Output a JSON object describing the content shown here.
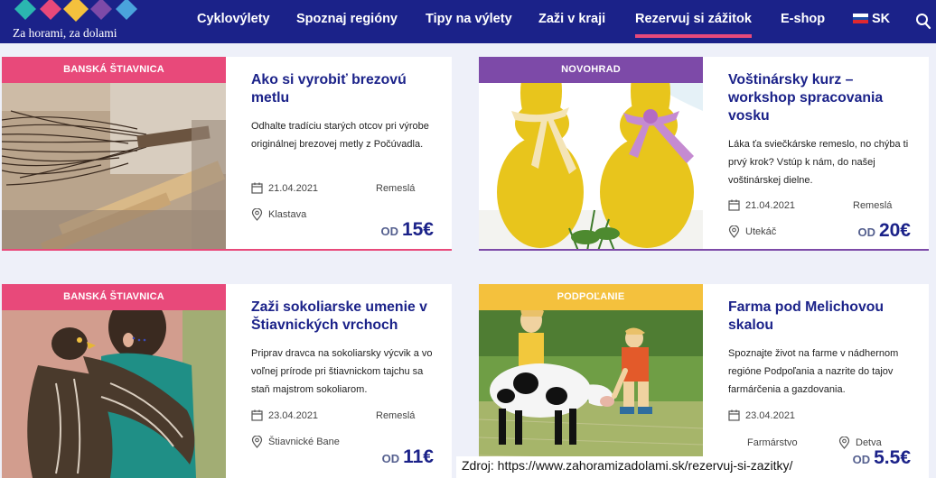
{
  "site": {
    "logo_text": "Za horami, za dolami"
  },
  "nav": {
    "items": [
      {
        "label": "Cyklovýlety"
      },
      {
        "label": "Spoznaj regióny"
      },
      {
        "label": "Tipy na výlety"
      },
      {
        "label": "Zaži v kraji"
      },
      {
        "label": "Rezervuj si zážitok",
        "active": true
      },
      {
        "label": "E-shop"
      }
    ],
    "language": "SK"
  },
  "cards": [
    {
      "region": "BANSKÁ ŠTIAVNICA",
      "region_color": "#e8497a",
      "title": "Ako si vyrobiť brezovú metlu",
      "description": "Odhalte tradíciu starých otcov pri výrobe originálnej brezovej metly z Počúvadla.",
      "date": "21.04.2021",
      "category": "Remeslá",
      "location": "Klastava",
      "price_prefix": "OD",
      "price": "15€"
    },
    {
      "region": "NOVOHRAD",
      "region_color": "#7d4aa8",
      "title": "Voštinársky kurz – workshop spracovania vosku",
      "description": "Láka ťa sviečkárske remeslo, no chýba ti prvý krok? Vstúp k nám, do našej voštinárskej dielne.",
      "date": "21.04.2021",
      "category": "Remeslá",
      "location": "Utekáč",
      "price_prefix": "OD",
      "price": "20€"
    },
    {
      "region": "BANSKÁ ŠTIAVNICA",
      "region_color": "#e8497a",
      "title": "Zaži sokoliarske umenie v Štiavnických vrchoch",
      "description": "Priprav dravca na sokoliarsky výcvik a vo voľnej prírode pri štiavnickom tajchu sa staň majstrom sokoliarom.",
      "date": "23.04.2021",
      "category": "Remeslá",
      "location": "Štiavnické Bane",
      "price_prefix": "OD",
      "price": "11€"
    },
    {
      "region": "PODPOĽANIE",
      "region_color": "#f4c13d",
      "title": "Farma pod Melichovou skalou",
      "description": "Spoznajte život na farme v nádhernom regióne Podpoľania a nazrite do tajov farmárčenia a gazdovania.",
      "date": "23.04.2021",
      "category": "Farmárstvo",
      "location": "Detva",
      "price_prefix": "OD",
      "price": "5.5€"
    }
  ],
  "source": "Zdroj: https://www.zahoramizadolami.sk/rezervuj-si-zazitky/",
  "colors": {
    "header_bg": "#1b2289",
    "accent": "#e8497a",
    "page_bg": "#eef0f9"
  }
}
